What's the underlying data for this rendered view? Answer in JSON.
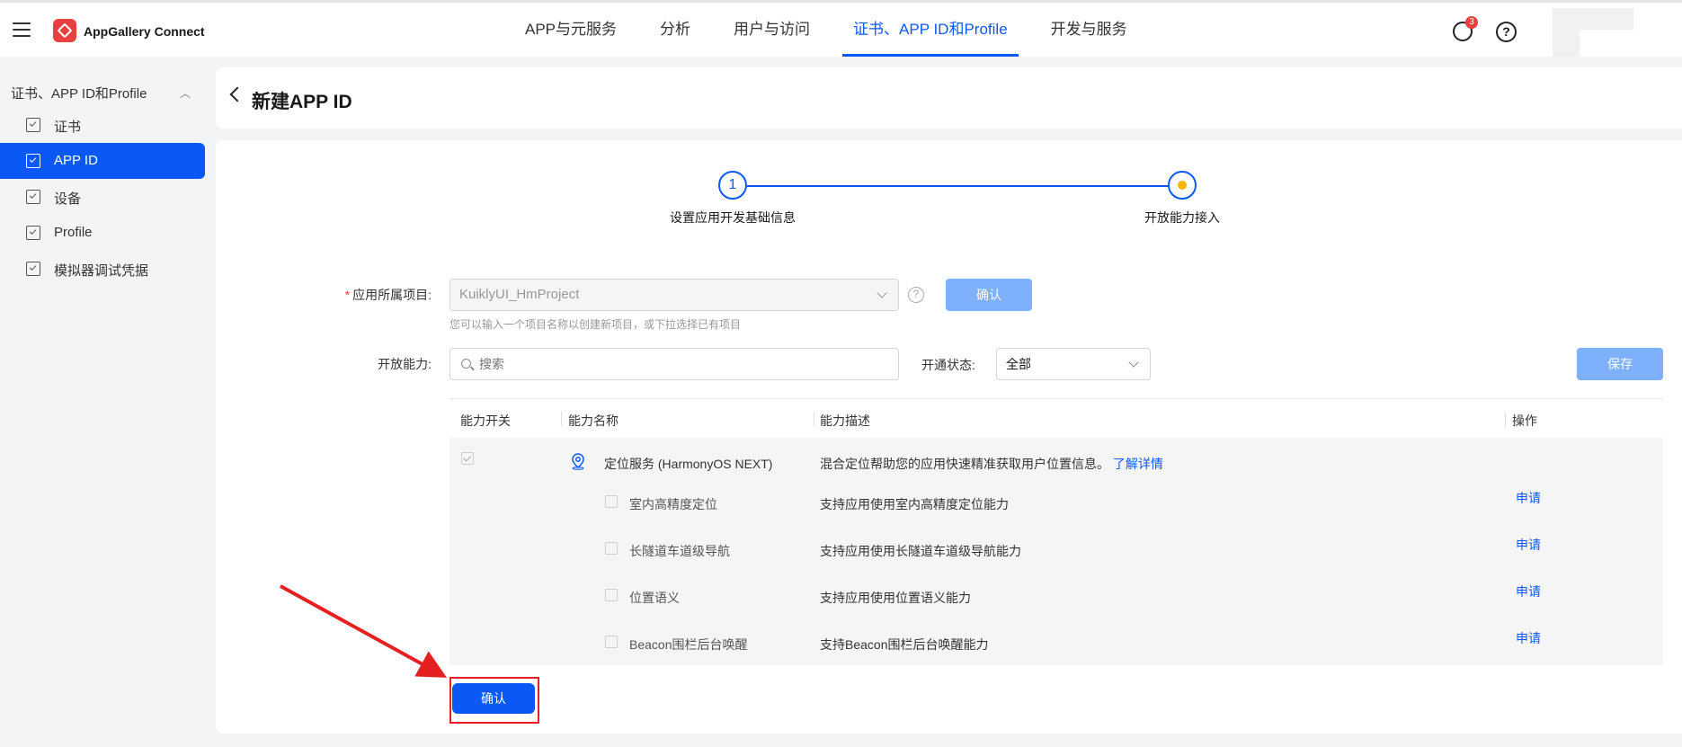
{
  "topbar": {
    "brand": "AppGallery Connect",
    "nav": [
      "APP与元服务",
      "分析",
      "用户与访问",
      "证书、APP ID和Profile",
      "开发与服务"
    ],
    "notif_count": "3",
    "help_glyph": "?"
  },
  "sidebar": {
    "group": "证书、APP ID和Profile",
    "items": [
      {
        "label": "证书"
      },
      {
        "label": "APP ID"
      },
      {
        "label": "设备"
      },
      {
        "label": "Profile"
      },
      {
        "label": "模拟器调试凭据"
      }
    ]
  },
  "header": {
    "title": "新建APP ID"
  },
  "steps": [
    {
      "num": "1",
      "label": "设置应用开发基础信息"
    },
    {
      "label": "开放能力接入"
    }
  ],
  "form": {
    "project_label": "应用所属项目:",
    "project_value": "KuiklyUI_HmProject",
    "confirm_label": "确认",
    "hint": "您可以输入一个项目名称以创建新项目，或下拉选择已有项目",
    "ability_label": "开放能力:",
    "search_placeholder": "搜索",
    "status_label": "开通状态:",
    "status_value": "全部",
    "save_label": "保存"
  },
  "table": {
    "headers": [
      "能力开关",
      "能力名称",
      "能力描述",
      "操作"
    ],
    "parent": {
      "name": "定位服务 (HarmonyOS NEXT)",
      "desc": "混合定位帮助您的应用快速精准获取用户位置信息。",
      "link": "了解详情"
    },
    "rows": [
      {
        "name": "室内高精度定位",
        "desc": "支持应用使用室内高精度定位能力",
        "action": "申请"
      },
      {
        "name": "长隧道车道级导航",
        "desc": "支持应用使用长隧道车道级导航能力",
        "action": "申请"
      },
      {
        "name": "位置语义",
        "desc": "支持应用使用位置语义能力",
        "action": "申请"
      },
      {
        "name": "Beacon围栏后台唤醒",
        "desc": "支持Beacon围栏后台唤醒能力",
        "action": "申请"
      }
    ]
  },
  "footer": {
    "confirm_label": "确认"
  },
  "colors": {
    "accent": "#0a59f7",
    "annotation": "#e52020",
    "step_dot": "#f7b500"
  }
}
